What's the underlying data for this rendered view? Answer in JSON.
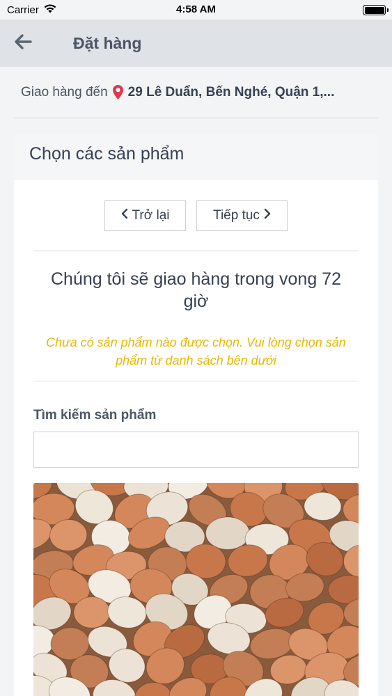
{
  "status_bar": {
    "carrier": "Carrier",
    "time": "4:58 AM"
  },
  "nav": {
    "title": "Đặt hàng"
  },
  "delivery": {
    "label": "Giao hàng đến",
    "address": "29 Lê Duẩn, Bến Nghé, Quận 1,..."
  },
  "card": {
    "title": "Chọn các sản phẩm",
    "back_label": "Trở lại",
    "next_label": "Tiếp tục",
    "delivery_time": "Chúng tôi sẽ giao hàng trong vong 72 giờ",
    "warning": "Chưa có sản phẩm nào được chọn. Vui lòng chọn sản phẩm từ danh sách bên dưới"
  },
  "search": {
    "label": "Tìm kiếm sản phẩm",
    "value": "",
    "placeholder": ""
  },
  "colors": {
    "warning": "#e8b800",
    "pin": "#e03a4a",
    "nav_bg": "#dfe3e8"
  },
  "icons": [
    "wifi-icon",
    "battery-icon",
    "back-arrow-icon",
    "location-pin-icon",
    "chevron-left-icon",
    "chevron-right-icon"
  ]
}
